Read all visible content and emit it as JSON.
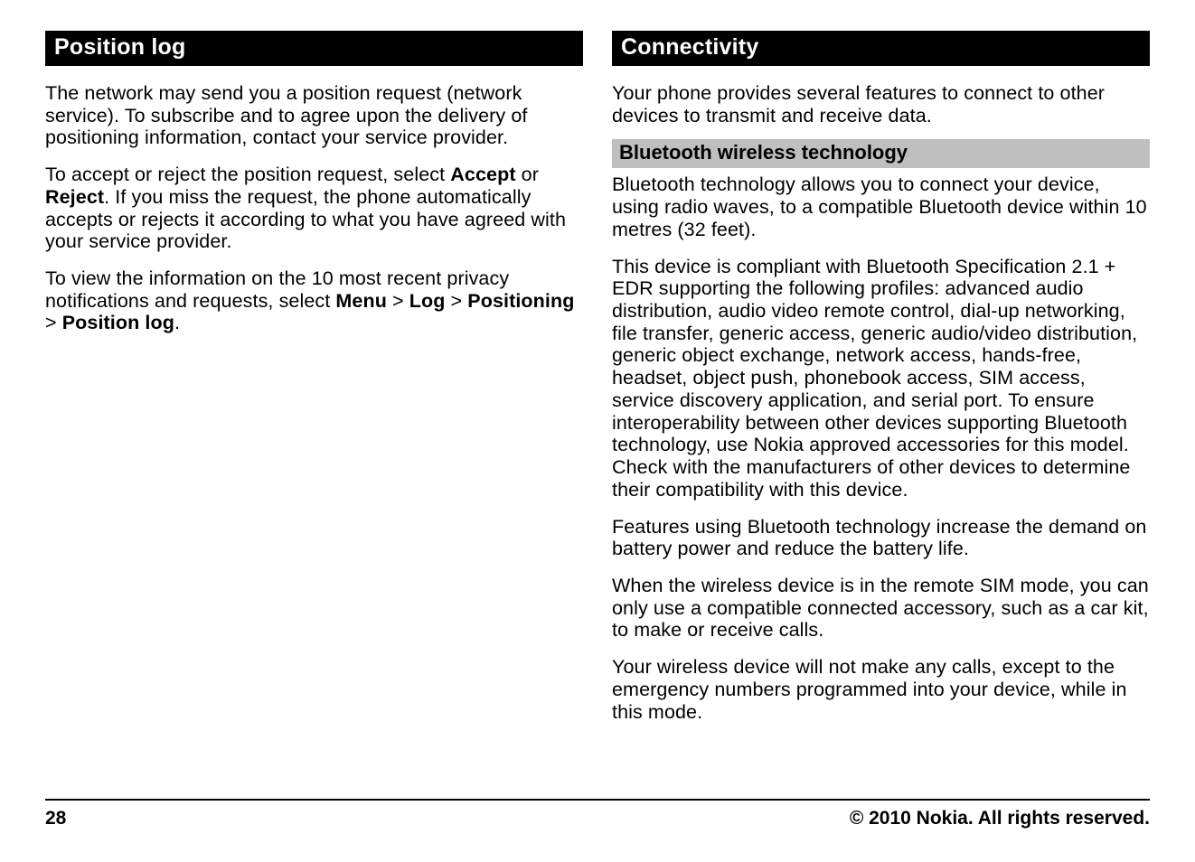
{
  "left": {
    "heading": "Position log",
    "p1": "The network may send you a position request (network service). To subscribe and to agree upon the delivery of positioning information, contact your service provider.",
    "p2_a": "To accept or reject the position request, select ",
    "p2_accept": "Accept",
    "p2_or": " or ",
    "p2_reject": "Reject",
    "p2_b": ". If you miss the request, the phone automatically accepts or rejects it according to what you have agreed with your service provider.",
    "p3_a": "To view the information on the 10 most recent privacy notifications and requests, select ",
    "p3_menu": "Menu",
    "p3_gt1": "  > ",
    "p3_log": "Log",
    "p3_gt2": "  > ",
    "p3_positioning": "Positioning",
    "p3_gt3": "  > ",
    "p3_poslog": "Position log",
    "p3_end": "."
  },
  "right": {
    "heading": "Connectivity",
    "p1": "Your phone provides several features to connect to other devices to transmit and receive data.",
    "sub": "Bluetooth wireless technology",
    "p2": "Bluetooth technology allows you to connect your device, using radio waves, to a compatible Bluetooth device within 10 metres (32 feet).",
    "p3": "This device is compliant with Bluetooth Specification 2.1 + EDR supporting the following profiles: advanced audio distribution, audio video remote control, dial-up networking, file transfer, generic access, generic audio/video distribution, generic object exchange, network access, hands-free, headset, object push, phonebook access, SIM access, service discovery application, and serial port. To ensure interoperability between other devices supporting Bluetooth technology, use Nokia approved accessories for this model. Check with the manufacturers of other devices to determine their compatibility with this device.",
    "p4": "Features using Bluetooth technology increase the demand on battery power and reduce the battery life.",
    "p5": "When the wireless device is in the remote SIM mode, you can only use a compatible connected accessory, such as a car kit, to make or receive calls.",
    "p6": "Your wireless device will not make any calls, except to the emergency numbers programmed into your device, while in this mode."
  },
  "footer": {
    "page": "28",
    "copyright": "© 2010 Nokia. All rights reserved."
  }
}
